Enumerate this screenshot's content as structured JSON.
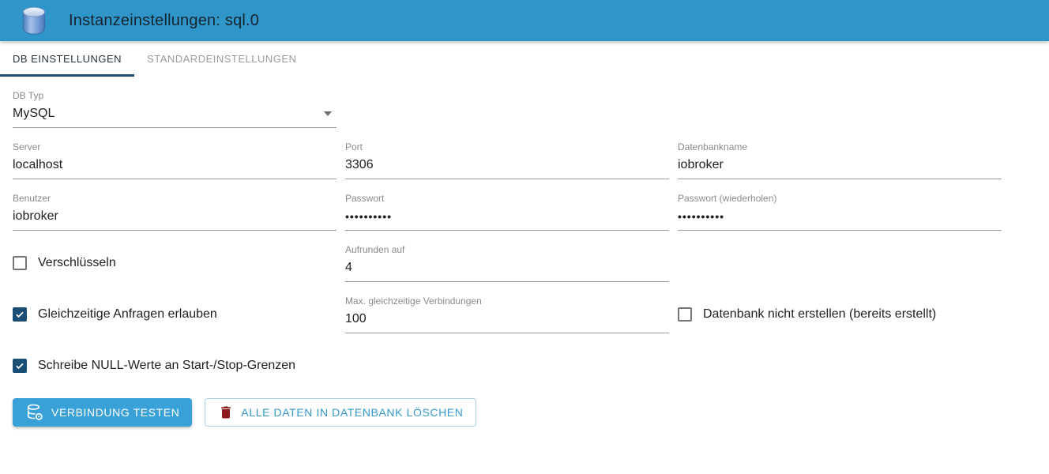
{
  "header": {
    "title": "Instanzeinstellungen: sql.0"
  },
  "tabs": [
    {
      "label": "DB EINSTELLUNGEN",
      "active": true
    },
    {
      "label": "STANDARDEINSTELLUNGEN",
      "active": false
    }
  ],
  "fields": {
    "db_type": {
      "label": "DB Typ",
      "value": "MySQL"
    },
    "server": {
      "label": "Server",
      "value": "localhost"
    },
    "port": {
      "label": "Port",
      "value": "3306"
    },
    "dbname": {
      "label": "Datenbankname",
      "value": "iobroker"
    },
    "user": {
      "label": "Benutzer",
      "value": "iobroker"
    },
    "password": {
      "label": "Passwort",
      "value": "••••••••••"
    },
    "password_repeat": {
      "label": "Passwort (wiederholen)",
      "value": "••••••••••"
    },
    "round": {
      "label": "Aufrunden auf",
      "value": "4"
    },
    "max_connections": {
      "label": "Max. gleichzeitige Verbindungen",
      "value": "100"
    }
  },
  "checkboxes": {
    "encrypt": {
      "label": "Verschlüsseln",
      "checked": false
    },
    "parallel": {
      "label": "Gleichzeitige Anfragen erlauben",
      "checked": true
    },
    "no_create": {
      "label": "Datenbank nicht erstellen (bereits erstellt)",
      "checked": false
    },
    "null_values": {
      "label": "Schreibe NULL-Werte an Start-/Stop-Grenzen",
      "checked": true
    }
  },
  "buttons": {
    "test_label": "VERBINDUNG TESTEN",
    "delete_label": "ALLE DATEN IN DATENBANK LÖSCHEN"
  },
  "colors": {
    "header_bg": "#3096c9",
    "accent_button": "#39a1d8",
    "checked_checkbox": "#1a4e74",
    "tab_indicator": "#1d4e72",
    "delete_icon": "#8b1a1a",
    "outline_button_text": "#3399cc"
  }
}
